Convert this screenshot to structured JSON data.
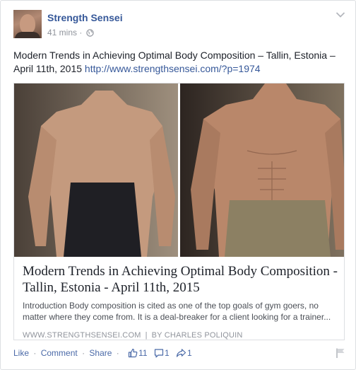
{
  "post": {
    "author": "Strength Sensei",
    "time": "41 mins",
    "time_sep": "·",
    "text": "Modern Trends in Achieving Optimal Body Composition – Tallin, Estonia – April 11th, 2015",
    "url": "http://www.strengthsensei.com/?p=1974"
  },
  "link_preview": {
    "title": "Modern Trends in Achieving Optimal Body Composition - Tallin, Estonia - April 11th, 2015",
    "description": "Introduction Body composition is cited as one of the top goals of gym goers, no matter where they come from. It is a deal-breaker for a client looking for a trainer...",
    "domain": "WWW.STRENGTHSENSEI.COM",
    "separator": "|",
    "byline": "BY CHARLES POLIQUIN"
  },
  "actions": {
    "like": "Like",
    "comment": "Comment",
    "share": "Share",
    "dot": "·",
    "likes_count": "11",
    "comments_count": "1",
    "shares_count": "1"
  },
  "colors": {
    "link_blue": "#365899",
    "meta_gray": "#90949c",
    "text": "#1d2129"
  }
}
